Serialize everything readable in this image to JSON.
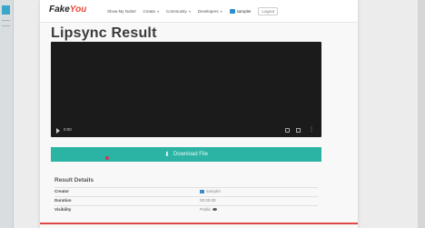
{
  "navbar": {
    "logo_main": "Fake",
    "logo_accent": "You",
    "items": [
      {
        "label": "Show My Nobel",
        "dropdown": false
      },
      {
        "label": "Create",
        "dropdown": true
      },
      {
        "label": "Community",
        "dropdown": true
      },
      {
        "label": "Developers",
        "dropdown": true
      }
    ],
    "user": "sampleI",
    "logout": "Logout"
  },
  "page_title": "Lipsync Result",
  "video": {
    "time": "0:00"
  },
  "download_button": "Download File",
  "results": {
    "title": "Result Details",
    "rows": [
      {
        "label": "Creator",
        "value": "sampleI"
      },
      {
        "label": "Duration",
        "value": "00:00:09"
      },
      {
        "label": "Visibility",
        "value": "Public"
      }
    ]
  },
  "colors": {
    "accent": "#2bb3a3",
    "brand": "#e8473a"
  }
}
